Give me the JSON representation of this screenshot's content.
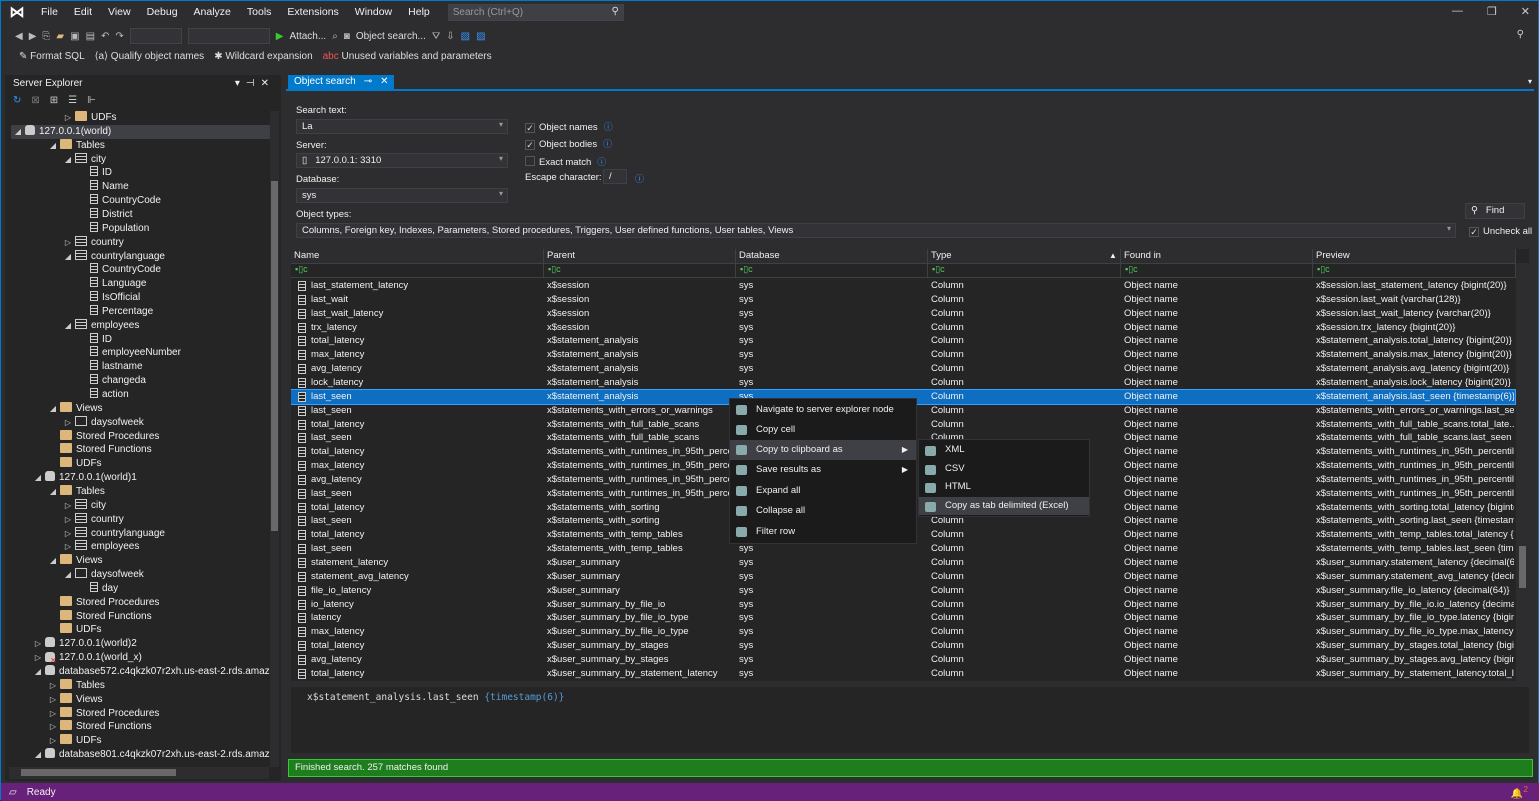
{
  "menu": {
    "items": [
      "File",
      "Edit",
      "View",
      "Debug",
      "Analyze",
      "Tools",
      "Extensions",
      "Window",
      "Help"
    ],
    "search_placeholder": "Search (Ctrl+Q)"
  },
  "toolbar": {
    "attach": "Attach...",
    "object_search": "Object search...",
    "format_sql": "Format SQL",
    "qualify": "Qualify object names",
    "wildcard": "Wildcard expansion",
    "unused": "Unused variables and parameters"
  },
  "server_explorer": {
    "title": "Server Explorer",
    "tree": [
      [
        "UDFs",
        2,
        "folder",
        "c"
      ],
      [
        "127.0.0.1(world)",
        0,
        "server",
        "e"
      ],
      [
        "Tables",
        1,
        "folder",
        "e"
      ],
      [
        "city",
        2,
        "table",
        "e"
      ],
      [
        "ID",
        3,
        "col",
        ""
      ],
      [
        "Name",
        3,
        "col",
        ""
      ],
      [
        "CountryCode",
        3,
        "col",
        ""
      ],
      [
        "District",
        3,
        "col",
        ""
      ],
      [
        "Population",
        3,
        "col",
        ""
      ],
      [
        "country",
        2,
        "table",
        "c"
      ],
      [
        "countrylanguage",
        2,
        "table",
        "e"
      ],
      [
        "CountryCode",
        3,
        "col",
        ""
      ],
      [
        "Language",
        3,
        "col",
        ""
      ],
      [
        "IsOfficial",
        3,
        "col",
        ""
      ],
      [
        "Percentage",
        3,
        "col",
        ""
      ],
      [
        "employees",
        2,
        "table",
        "e"
      ],
      [
        "ID",
        3,
        "col",
        ""
      ],
      [
        "employeeNumber",
        3,
        "col",
        ""
      ],
      [
        "lastname",
        3,
        "col",
        ""
      ],
      [
        "changeda",
        3,
        "col",
        ""
      ],
      [
        "action",
        3,
        "col",
        ""
      ],
      [
        "Views",
        1,
        "folder",
        "e"
      ],
      [
        "daysofweek",
        2,
        "view",
        "c"
      ],
      [
        "Stored Procedures",
        1,
        "folder",
        ""
      ],
      [
        "Stored Functions",
        1,
        "folder",
        ""
      ],
      [
        "UDFs",
        1,
        "folder",
        ""
      ],
      [
        "127.0.0.1(world)1",
        0,
        "server",
        "e"
      ],
      [
        "Tables",
        1,
        "folder",
        "e"
      ],
      [
        "city",
        2,
        "table",
        "c"
      ],
      [
        "country",
        2,
        "table",
        "c"
      ],
      [
        "countrylanguage",
        2,
        "table",
        "c"
      ],
      [
        "employees",
        2,
        "table",
        "c"
      ],
      [
        "Views",
        1,
        "folder",
        "e"
      ],
      [
        "daysofweek",
        2,
        "view",
        "e"
      ],
      [
        "day",
        3,
        "col",
        ""
      ],
      [
        "Stored Procedures",
        1,
        "folder",
        ""
      ],
      [
        "Stored Functions",
        1,
        "folder",
        ""
      ],
      [
        "UDFs",
        1,
        "folder",
        ""
      ],
      [
        "127.0.0.1(world)2",
        0,
        "server",
        "c"
      ],
      [
        "127.0.0.1(world_x)",
        0,
        "server",
        "c"
      ],
      [
        "database572.c4qkzk07r2xh.us-east-2.rds.amazon",
        0,
        "server",
        "e"
      ],
      [
        "Tables",
        1,
        "folder",
        "c"
      ],
      [
        "Views",
        1,
        "folder",
        "c"
      ],
      [
        "Stored Procedures",
        1,
        "folder",
        "c"
      ],
      [
        "Stored Functions",
        1,
        "folder",
        "c"
      ],
      [
        "UDFs",
        1,
        "folder",
        "c"
      ],
      [
        "database801.c4qkzk07r2xh.us-east-2.rds.amazon",
        0,
        "server",
        "e"
      ]
    ]
  },
  "tab": {
    "title": "Object search"
  },
  "form": {
    "search_text_label": "Search text:",
    "search_text": "La",
    "server_label": "Server:",
    "server": "127.0.0.1: 3310",
    "database_label": "Database:",
    "database": "sys",
    "object_names": "Object names",
    "object_bodies": "Object bodies",
    "exact_match": "Exact match",
    "escape_label": "Escape character:",
    "escape": "/",
    "object_types_label": "Object types:",
    "object_types": "Columns, Foreign key, Indexes, Parameters, Stored procedures, Triggers, User defined functions, User tables, Views",
    "find": "Find",
    "uncheck_all": "Uncheck all"
  },
  "grid": {
    "columns": [
      "Name",
      "Parent",
      "Database",
      "Type",
      "Found in",
      "Preview"
    ],
    "rows": [
      [
        "last_statement_latency",
        "x$session",
        "x$session.last_statement_latency {bigint(20)}"
      ],
      [
        "last_wait",
        "x$session",
        "x$session.last_wait {varchar(128)}"
      ],
      [
        "last_wait_latency",
        "x$session",
        "x$session.last_wait_latency {varchar(20)}"
      ],
      [
        "trx_latency",
        "x$session",
        "x$session.trx_latency {bigint(20)}"
      ],
      [
        "total_latency",
        "x$statement_analysis",
        "x$statement_analysis.total_latency {bigint(20)}"
      ],
      [
        "max_latency",
        "x$statement_analysis",
        "x$statement_analysis.max_latency {bigint(20)}"
      ],
      [
        "avg_latency",
        "x$statement_analysis",
        "x$statement_analysis.avg_latency {bigint(20)}"
      ],
      [
        "lock_latency",
        "x$statement_analysis",
        "x$statement_analysis.lock_latency {bigint(20)}"
      ],
      [
        "last_seen",
        "x$statement_analysis",
        "x$statement_analysis.last_seen {timestamp(6)}"
      ],
      [
        "last_seen",
        "x$statements_with_errors_or_warnings",
        "x$statements_with_errors_or_warnings.last_se..."
      ],
      [
        "total_latency",
        "x$statements_with_full_table_scans",
        "x$statements_with_full_table_scans.total_late..."
      ],
      [
        "last_seen",
        "x$statements_with_full_table_scans",
        "x$statements_with_full_table_scans.last_seen {..."
      ],
      [
        "total_latency",
        "x$statements_with_runtimes_in_95th_perce...",
        "x$statements_with_runtimes_in_95th_percentil..."
      ],
      [
        "max_latency",
        "x$statements_with_runtimes_in_95th_perce...",
        "x$statements_with_runtimes_in_95th_percentil..."
      ],
      [
        "avg_latency",
        "x$statements_with_runtimes_in_95th_perce...",
        "x$statements_with_runtimes_in_95th_percentil..."
      ],
      [
        "last_seen",
        "x$statements_with_runtimes_in_95th_perce...",
        "x$statements_with_runtimes_in_95th_percentil..."
      ],
      [
        "total_latency",
        "x$statements_with_sorting",
        "x$statements_with_sorting.total_latency {bigint(..."
      ],
      [
        "last_seen",
        "x$statements_with_sorting",
        "x$statements_with_sorting.last_seen {timestam..."
      ],
      [
        "total_latency",
        "x$statements_with_temp_tables",
        "x$statements_with_temp_tables.total_latency {..."
      ],
      [
        "last_seen",
        "x$statements_with_temp_tables",
        "x$statements_with_temp_tables.last_seen {time..."
      ],
      [
        "statement_latency",
        "x$user_summary",
        "x$user_summary.statement_latency {decimal(64)}"
      ],
      [
        "statement_avg_latency",
        "x$user_summary",
        "x$user_summary.statement_avg_latency {decim..."
      ],
      [
        "file_io_latency",
        "x$user_summary",
        "x$user_summary.file_io_latency {decimal(64)}"
      ],
      [
        "io_latency",
        "x$user_summary_by_file_io",
        "x$user_summary_by_file_io.io_latency {decimal(..."
      ],
      [
        "latency",
        "x$user_summary_by_file_io_type",
        "x$user_summary_by_file_io_type.latency {bigint..."
      ],
      [
        "max_latency",
        "x$user_summary_by_file_io_type",
        "x$user_summary_by_file_io_type.max_latency {..."
      ],
      [
        "total_latency",
        "x$user_summary_by_stages",
        "x$user_summary_by_stages.total_latency {bigin..."
      ],
      [
        "avg_latency",
        "x$user_summary_by_stages",
        "x$user_summary_by_stages.avg_latency {bigint..."
      ],
      [
        "total_latency",
        "x$user_summary_by_statement_latency",
        "x$user_summary_by_statement_latency.total_l..."
      ]
    ],
    "database_value": "sys",
    "type_value": "Column",
    "found_in_value": "Object name",
    "selected_index": 8
  },
  "preview": {
    "name": "x$statement_analysis.last_seen",
    "type": "{timestamp(6)}"
  },
  "context_menu": {
    "items": [
      "Navigate to server explorer node",
      "Copy cell",
      "Copy to clipboard as",
      "Save results as",
      "Expand all",
      "Collapse all",
      "Filter row"
    ],
    "submenu": [
      "XML",
      "CSV",
      "HTML",
      "Copy as tab delimited (Excel)"
    ]
  },
  "status": {
    "search_result": "Finished search. 257 matches found",
    "ready": "Ready",
    "notifications": "2"
  },
  "colors": {
    "accent": "#007acc",
    "statusbar": "#68217a",
    "success": "#1e7e1e",
    "selection": "#0e6fc2"
  }
}
